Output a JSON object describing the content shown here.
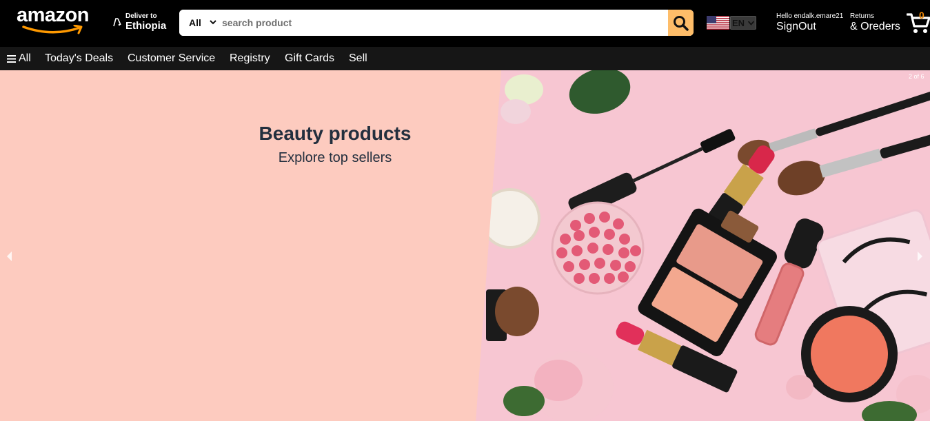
{
  "header": {
    "logo_text": "amazon",
    "deliver_small": "Deliver to",
    "deliver_location": "Ethiopia",
    "search": {
      "category": "All",
      "placeholder": "search product",
      "value": ""
    },
    "language": "EN",
    "account_greeting": "Hello endalk.emare21",
    "account_action": "SignOut",
    "returns_small": "Returns",
    "orders_label": "& Oreders",
    "cart_count": "0"
  },
  "nav": {
    "all_label": "All",
    "items": [
      "Today's Deals",
      "Customer Service",
      "Registry",
      "Gift Cards",
      "Sell"
    ]
  },
  "hero": {
    "title": "Beauty products",
    "subtitle": "Explore top sellers",
    "slide_counter": "2 of 6"
  },
  "colors": {
    "header_bg": "#000000",
    "nav_bg": "#161616",
    "search_button": "#febd69",
    "hero_bg": "#fdcbbf",
    "cart_count": "#f08804",
    "hero_text": "#232f3e"
  },
  "icons": [
    "location-pin-icon",
    "chevron-down-icon",
    "search-icon",
    "us-flag-icon",
    "cart-icon",
    "hamburger-icon",
    "arrow-left-icon",
    "arrow-right-icon",
    "amazon-smile-icon"
  ]
}
